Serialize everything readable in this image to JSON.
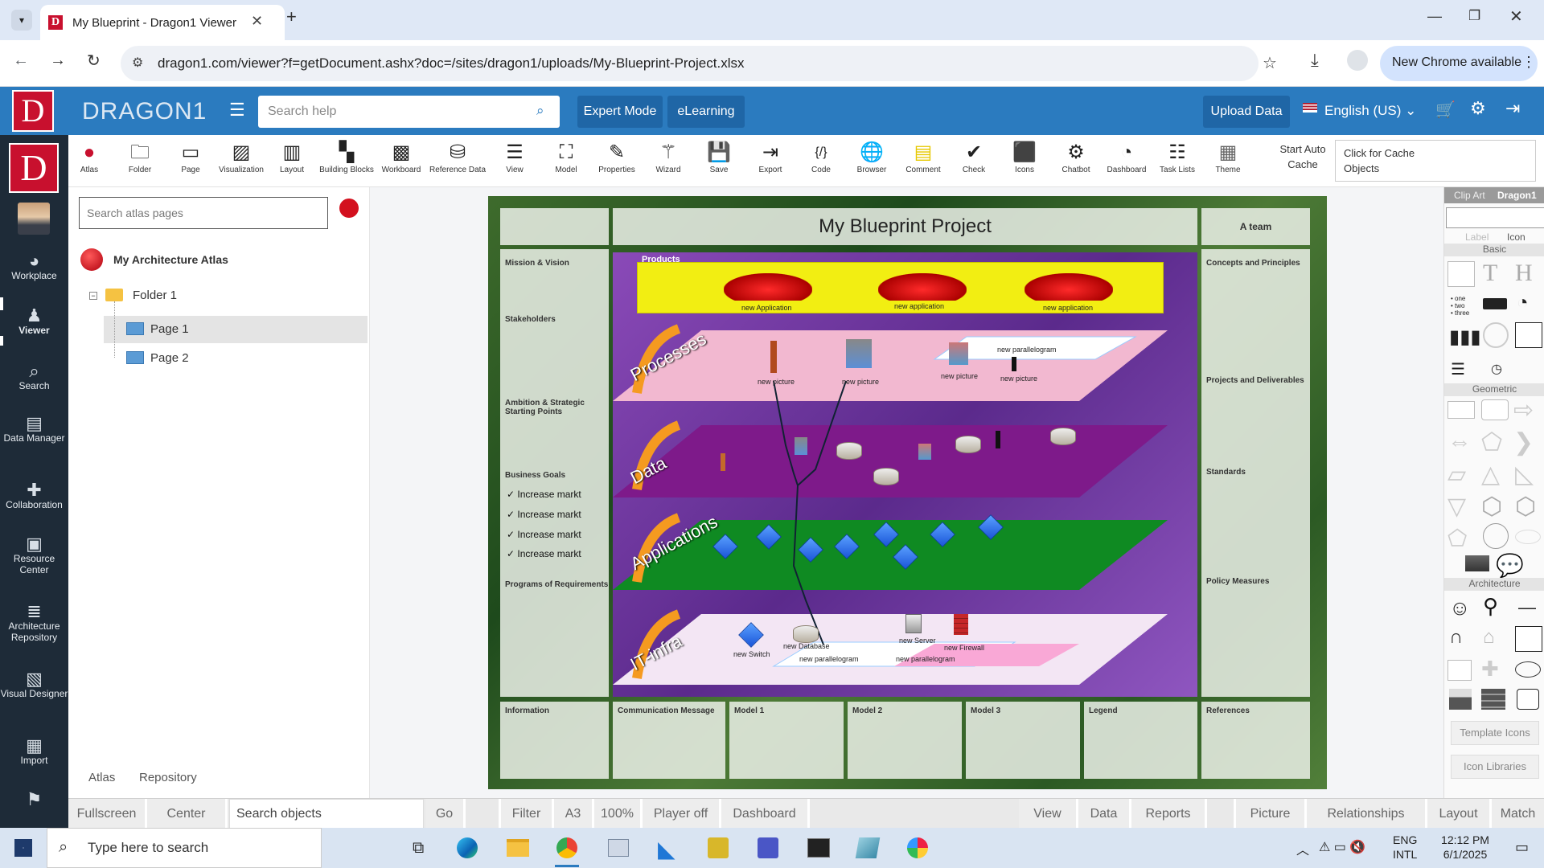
{
  "browser": {
    "tab_title": "My Blueprint - Dragon1 Viewer",
    "url": "dragon1.com/viewer?f=getDocument.ashx?doc=/sites/dragon1/uploads/My-Blueprint-Project.xlsx",
    "new_chrome": "New Chrome available"
  },
  "header": {
    "brand": "DRAGON1",
    "search_placeholder": "Search help",
    "expert_mode": "Expert Mode",
    "elearning": "eLearning",
    "upload_data": "Upload Data",
    "language": "English (US)"
  },
  "sidebar": {
    "items": [
      {
        "label": "Workplace",
        "icon": "palette-icon"
      },
      {
        "label": "Viewer",
        "icon": "person-icon"
      },
      {
        "label": "Search",
        "icon": "search-icon"
      },
      {
        "label": "Data Manager",
        "icon": "table-icon"
      },
      {
        "label": "Collaboration",
        "icon": "puzzle-icon"
      },
      {
        "label": "Resource Center",
        "icon": "book-icon"
      },
      {
        "label": "Architecture Repository",
        "icon": "database-icon"
      },
      {
        "label": "Visual Designer",
        "icon": "image-icon"
      },
      {
        "label": "Import",
        "icon": "grid-icon"
      }
    ]
  },
  "toolbar": {
    "tools": [
      "Atlas",
      "Folder",
      "Page",
      "Visualization",
      "Layout",
      "Building Blocks",
      "Workboard",
      "Reference Data",
      "View",
      "Model",
      "Properties",
      "Wizard",
      "Save",
      "Export",
      "Code",
      "Browser",
      "Comment",
      "Check",
      "Icons",
      "Chatbot",
      "Dashboard",
      "Task Lists",
      "Theme"
    ],
    "start_auto_cache": "Start Auto Cache",
    "click_for_cache": "Click for Cache Objects"
  },
  "left_panel": {
    "search_placeholder": "Search atlas pages",
    "atlas_title": "My Architecture Atlas",
    "folder": "Folder 1",
    "pages": [
      "Page 1",
      "Page 2"
    ],
    "tabs": [
      "Atlas",
      "Repository"
    ]
  },
  "blueprint": {
    "title": "My Blueprint Project",
    "team": "A team",
    "left_cells": [
      "Mission & Vision",
      "Stakeholders",
      "Ambition & Strategic Starting Points",
      "Business Goals",
      "Programs of Requirements"
    ],
    "goals": [
      "✓ Increase markt",
      "✓ Increase markt",
      "✓ Increase markt",
      "✓ Increase markt"
    ],
    "right_cells": [
      "Concepts and Principles",
      "Projects and Deliverables",
      "Standards",
      "Policy Measures"
    ],
    "bottom_cells": [
      "Information",
      "Communication Message",
      "Model 1",
      "Model 2",
      "Model 3",
      "Legend",
      "References"
    ],
    "products_label": "Products",
    "product_items": [
      "new Application",
      "new application",
      "new application"
    ],
    "layers": [
      "Processes",
      "Data",
      "Applications",
      "IT-infra"
    ],
    "process_items": [
      "new picture",
      "new picture",
      "new picture",
      "new picture"
    ],
    "process_parallelogram": "new parallelogram",
    "infra_items": [
      "new Switch",
      "new Database",
      "new Server",
      "new Firewall"
    ],
    "infra_parallelograms": [
      "new parallelogram",
      "new parallelogram"
    ]
  },
  "right_panel": {
    "tabs": [
      "Clip Art",
      "Dragon1"
    ],
    "subtabs": [
      "Label",
      "Icon"
    ],
    "sections": [
      "Basic",
      "Geometric",
      "Architecture"
    ],
    "template_icons": "Template Icons",
    "icon_libraries": "Icon Libraries"
  },
  "bottom_bar": {
    "items": [
      "Fullscreen",
      "Center",
      "Go",
      "Filter",
      "A3",
      "100%",
      "Player off",
      "Dashboard",
      "View",
      "Data",
      "Reports",
      "Picture",
      "Relationships",
      "Layout",
      "Match"
    ],
    "search_placeholder": "Search objects"
  },
  "taskbar": {
    "search_placeholder": "Type here to search",
    "lang1": "ENG",
    "lang2": "INTL",
    "time": "12:12 PM",
    "date": "6/1/2025"
  }
}
